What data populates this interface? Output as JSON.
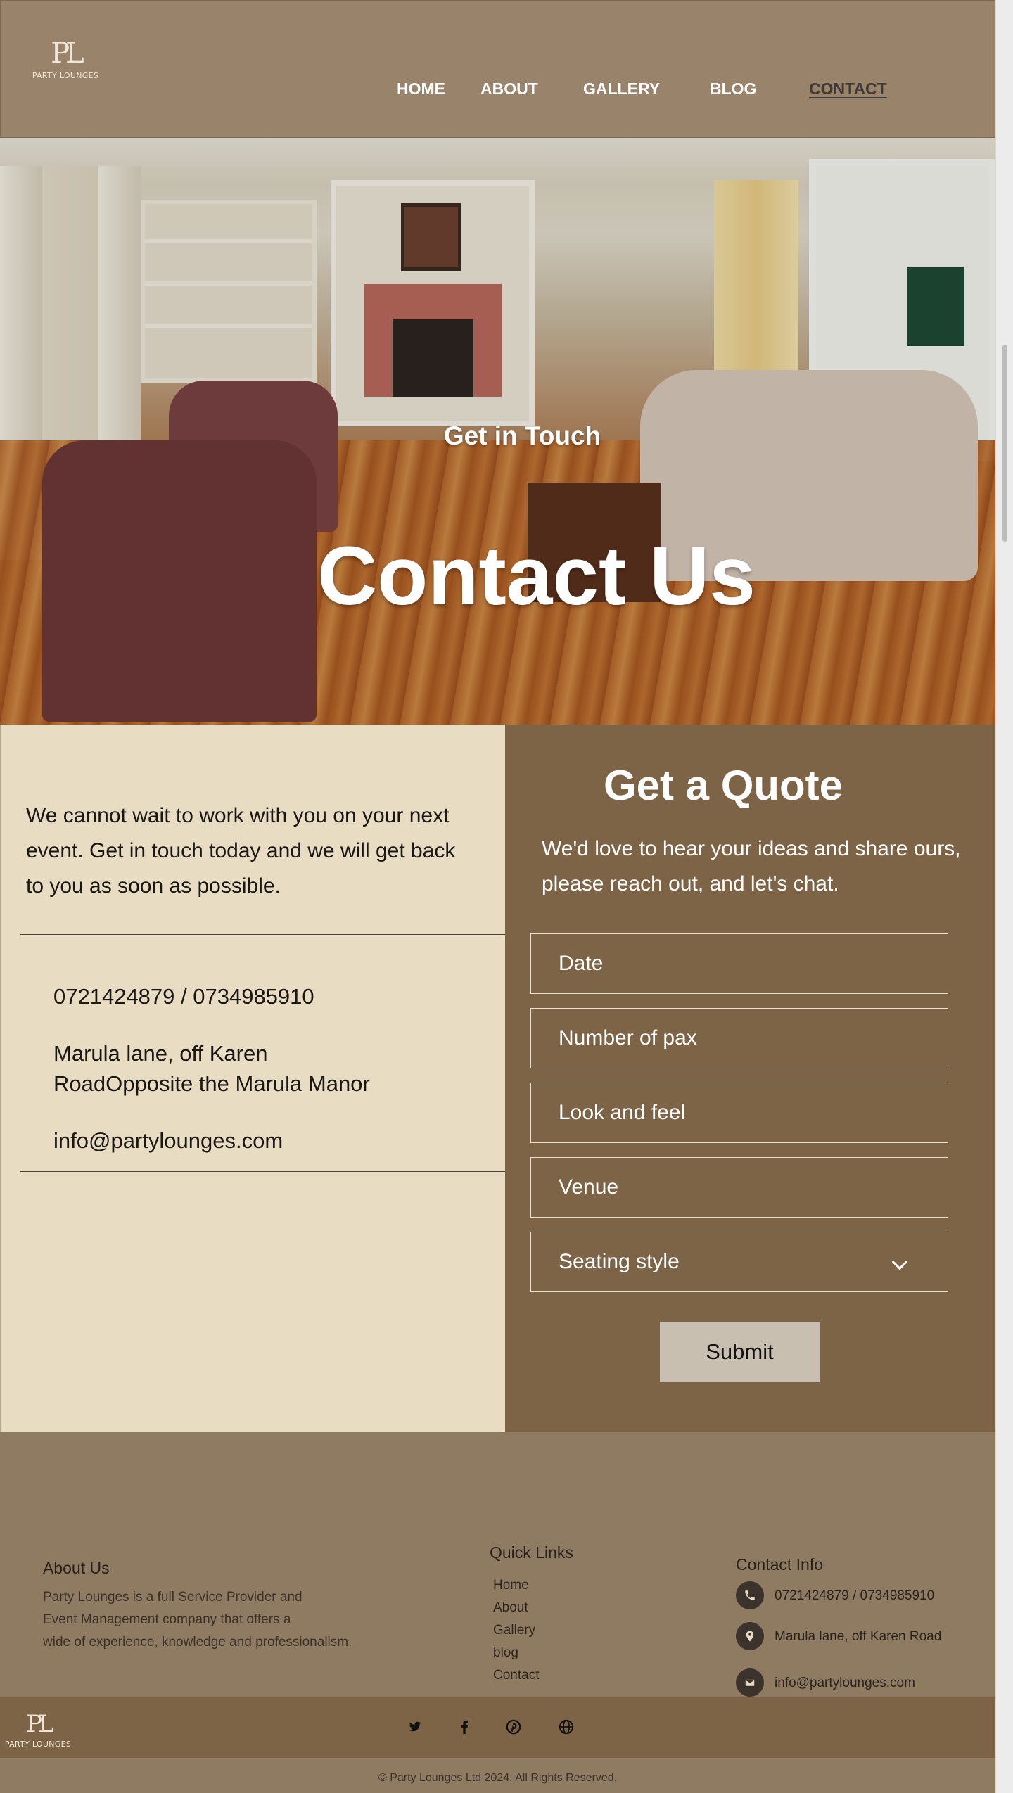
{
  "brand": {
    "logo_mark": "PL",
    "logo_text": "PARTY LOUNGES"
  },
  "nav": [
    {
      "label": "HOME"
    },
    {
      "label": "ABOUT"
    },
    {
      "label": "GALLERY"
    },
    {
      "label": "BLOG"
    },
    {
      "label": "CONTACT",
      "active": true
    }
  ],
  "hero": {
    "subtitle": "Get in Touch",
    "title": "Contact Us"
  },
  "contact": {
    "intro": "We cannot wait to work with you on your next event. Get in touch today and we will get back to you as soon as possible.",
    "phone": "0721424879 / 0734985910",
    "address_line1": "Marula lane, off Karen",
    "address_line2": "RoadOpposite the Marula Manor",
    "email": "info@partylounges.com"
  },
  "quote": {
    "title": "Get a Quote",
    "subtitle": "We'd love to hear your ideas and share ours, please reach out, and let's chat.",
    "fields": [
      {
        "placeholder": "Date"
      },
      {
        "placeholder": "Number of pax"
      },
      {
        "placeholder": "Look and feel"
      },
      {
        "placeholder": "Venue"
      }
    ],
    "seating_select": "Seating style",
    "submit_label": "Submit"
  },
  "footer": {
    "about_title": "About Us",
    "about_lines": [
      "Party Lounges is a full Service Provider and",
      "Event Management company that offers a",
      "wide of experience, knowledge and professionalism."
    ],
    "links_title": "Quick Links",
    "links": [
      "Home",
      "About",
      "Gallery",
      "blog",
      "Contact"
    ],
    "contact_title": "Contact Info",
    "contact_phone": "0721424879 / 0734985910",
    "contact_address": "Marula lane, off Karen Road",
    "contact_email": "info@partylounges.com",
    "social": [
      "twitter-icon",
      "facebook-icon",
      "pinterest-icon",
      "globe-icon"
    ],
    "copyright": "© Party Lounges Ltd 2024, All Rights Reserved."
  },
  "colors": {
    "header": "#99836a",
    "panel_light": "#e8dcc2",
    "panel_dark": "#7d6446",
    "footer": "#8f7a62",
    "submit": "#c9bfb1"
  }
}
